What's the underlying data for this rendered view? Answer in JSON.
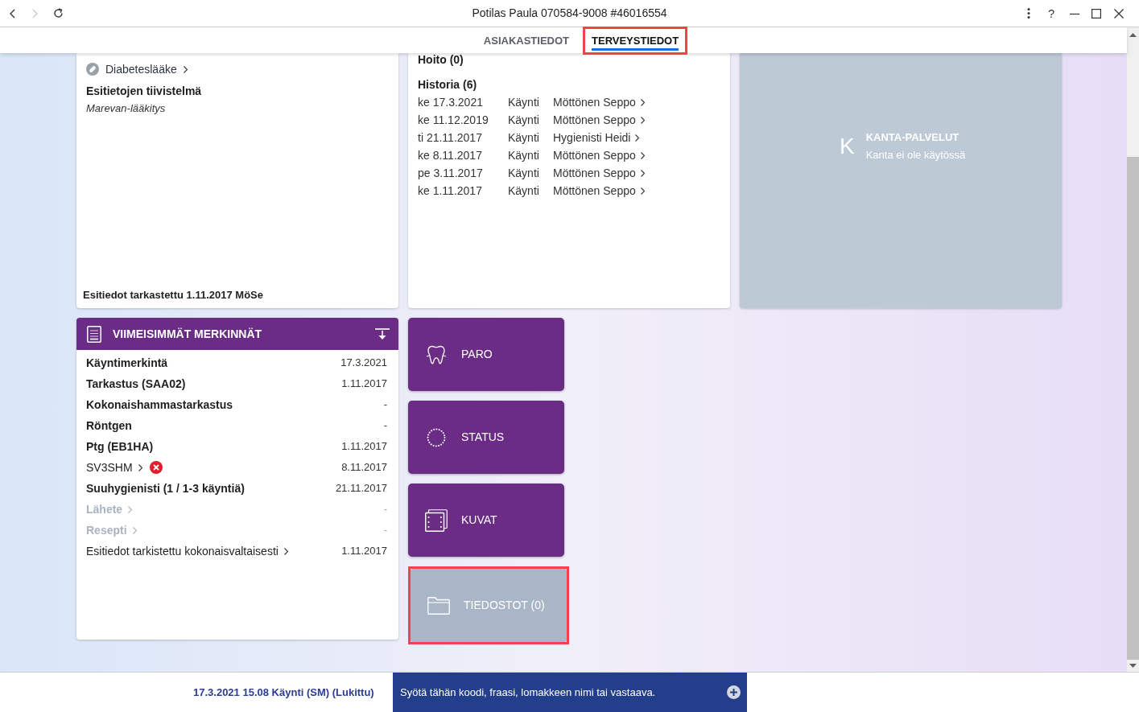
{
  "window": {
    "title": "Potilas Paula 070584-9008 #46016554",
    "help_label": "?"
  },
  "navigation": {
    "back": {
      "disabled": false
    },
    "forward": {
      "disabled": true
    }
  },
  "tabs": [
    {
      "label": "ASIAKASTIEDOT",
      "selected": false,
      "highlighted": false
    },
    {
      "label": "TERVEYSTIEDOT",
      "selected": true,
      "highlighted": true
    }
  ],
  "summary_card": {
    "links": [
      {
        "label": "Diabeteslääke"
      }
    ],
    "heading": "Esitietojen tiivistelmä",
    "note": "Marevan-lääkitys",
    "footer": "Esitiedot tarkastettu 1.11.2017 MöSe"
  },
  "care_card": {
    "treatment": {
      "title": "Hoito (0)"
    },
    "history": {
      "title": "Historia (6)",
      "rows": [
        {
          "date": "ke 17.3.2021",
          "type": "Käynti",
          "person": "Möttönen Seppo"
        },
        {
          "date": "ke 11.12.2019",
          "type": "Käynti",
          "person": "Möttönen Seppo"
        },
        {
          "date": "ti 21.11.2017",
          "type": "Käynti",
          "person": "Hygienisti Heidi"
        },
        {
          "date": "ke 8.11.2017",
          "type": "Käynti",
          "person": "Möttönen Seppo"
        },
        {
          "date": "pe 3.11.2017",
          "type": "Käynti",
          "person": "Möttönen Seppo"
        },
        {
          "date": "ke 1.11.2017",
          "type": "Käynti",
          "person": "Möttönen Seppo"
        }
      ]
    }
  },
  "kanta": {
    "logo": "K",
    "title": "KANTA-PALVELUT",
    "subtitle": "Kanta ei ole käytössä"
  },
  "recent_entries": {
    "title": "VIIMEISIMMÄT MERKINNÄT",
    "rows": [
      {
        "label": "Käyntimerkintä",
        "value": "17.3.2021",
        "link": false,
        "error": false,
        "disabled": false
      },
      {
        "label": "Tarkastus (SAA02)",
        "value": "1.11.2017",
        "link": false,
        "error": false,
        "disabled": false
      },
      {
        "label": "Kokonaishammastarkastus",
        "value": "-",
        "link": false,
        "error": false,
        "disabled": false
      },
      {
        "label": "Röntgen",
        "value": "-",
        "link": false,
        "error": false,
        "disabled": false
      },
      {
        "label": "Ptg (EB1HA)",
        "value": "1.11.2017",
        "link": false,
        "error": false,
        "disabled": false
      },
      {
        "label": "SV3SHM",
        "value": "8.11.2017",
        "link": true,
        "error": true,
        "disabled": false
      },
      {
        "label": "Suuhygienisti (1 / 1-3 käyntiä)",
        "value": "21.11.2017",
        "link": false,
        "error": false,
        "disabled": false
      },
      {
        "label": "Lähete",
        "value": "-",
        "link": true,
        "error": false,
        "disabled": true
      },
      {
        "label": "Resepti",
        "value": "-",
        "link": true,
        "error": false,
        "disabled": true
      },
      {
        "label": "Esitiedot tarkistettu kokonaisvaltaisesti",
        "value": "1.11.2017",
        "link": true,
        "error": false,
        "disabled": false
      }
    ]
  },
  "tiles": [
    {
      "label": "PARO",
      "kind": "tooth",
      "disabled": false,
      "highlighted": false
    },
    {
      "label": "STATUS",
      "kind": "ring",
      "disabled": false,
      "highlighted": false
    },
    {
      "label": "KUVAT",
      "kind": "images",
      "disabled": false,
      "highlighted": false
    },
    {
      "label": "TIEDOSTOT (0)",
      "kind": "folder",
      "disabled": true,
      "highlighted": true
    }
  ],
  "status_bar": {
    "visit": "17.3.2021 15.08 Käynti (SM) (Lukittu)",
    "command_field": {
      "placeholder": "Syötä tähän koodi, fraasi, lomakkeen nimi tai vastaava."
    }
  }
}
